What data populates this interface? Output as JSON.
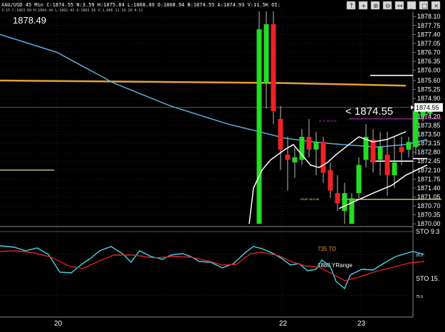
{
  "header": {
    "line1": "XAU/USD 45 Min  C:1874.55  N:3.59  H:1875.84  L:1868.49  O:1868.94  B:1874.55  A:1874.93  V:11.5K  OI:",
    "line2": "3:15  C:1863.69  H:1864.44  L:1862.43  O:1863.56  V:1,686  11-19-20  4:11"
  },
  "toolbar_icons": [
    "price-line-icon",
    "crosshair-icon",
    "zoom-in-icon",
    "zoom-out-icon",
    "pan-icon",
    "minimize-icon",
    "restore-icon",
    "close-icon"
  ],
  "top_price": "1878.49",
  "current_price_callout": "< 1874.55",
  "current_price_label": "1874.55",
  "annotations": {
    "magenta": "► W 1874.18",
    "yellow": "RSVP 1870.96",
    "td": "735 TD",
    "yrange": "1888 YRange"
  },
  "colors": {
    "up": "#22dd22",
    "down": "#ee2222",
    "ma_blue": "#5aaee0",
    "orange": "#e8a033",
    "white": "#ffffff",
    "yellow": "#e8e08a",
    "magenta": "#cc33cc",
    "sto_cyan": "#44d8ee",
    "sto_red": "#dd2222",
    "td_orange": "#f08a30",
    "grid": "#a0a0a0"
  },
  "chart_data": [
    {
      "type": "candlestick",
      "symbol": "XAU/USD",
      "timeframe": "45 Min",
      "y_axis": {
        "ticks": [
          "1870.00",
          "1870.35",
          "1870.70",
          "1871.05",
          "1871.40",
          "1871.75",
          "1872.10",
          "1872.45",
          "1872.80",
          "1873.15",
          "1873.50",
          "1873.85",
          "1874.20",
          "1874.55",
          "1874.90",
          "1875.25",
          "1875.60",
          "1876.00",
          "1876.35",
          "1876.70",
          "1877.05",
          "1877.40",
          "1877.75",
          "1878.10"
        ],
        "ylim": [
          1869.95,
          1878.3
        ]
      },
      "x_axis": {
        "ticks": [
          {
            "label": "20",
            "x": 40
          },
          {
            "label": "22",
            "x": 198
          },
          {
            "label": "23",
            "x": 253
          }
        ]
      },
      "grid": true,
      "candles": [
        {
          "x": 182,
          "o": 1870.0,
          "h": 1878.3,
          "l": 1870.0,
          "c": 1877.6
        },
        {
          "x": 187,
          "o": 1875.5,
          "h": 1878.3,
          "l": 1874.5,
          "c": 1877.8
        },
        {
          "x": 192,
          "o": 1877.8,
          "h": 1878.3,
          "l": 1873.9,
          "c": 1874.4
        },
        {
          "x": 197,
          "o": 1874.1,
          "h": 1874.6,
          "l": 1872.1,
          "c": 1872.9
        },
        {
          "x": 202,
          "o": 1872.7,
          "h": 1873.4,
          "l": 1871.3,
          "c": 1872.5
        },
        {
          "x": 207,
          "o": 1872.4,
          "h": 1873.0,
          "l": 1871.8,
          "c": 1872.6
        },
        {
          "x": 212,
          "o": 1872.5,
          "h": 1873.7,
          "l": 1872.3,
          "c": 1873.4
        },
        {
          "x": 217,
          "o": 1873.4,
          "h": 1874.1,
          "l": 1872.6,
          "c": 1872.9
        },
        {
          "x": 222,
          "o": 1872.9,
          "h": 1873.6,
          "l": 1871.9,
          "c": 1873.2
        },
        {
          "x": 227,
          "o": 1873.2,
          "h": 1873.4,
          "l": 1871.6,
          "c": 1872.0
        },
        {
          "x": 232,
          "o": 1872.1,
          "h": 1872.4,
          "l": 1871.0,
          "c": 1871.3
        },
        {
          "x": 237,
          "o": 1871.2,
          "h": 1871.9,
          "l": 1870.5,
          "c": 1870.8
        },
        {
          "x": 242,
          "o": 1870.5,
          "h": 1871.6,
          "l": 1870.0,
          "c": 1871.2
        },
        {
          "x": 247,
          "o": 1870.0,
          "h": 1871.2,
          "l": 1870.0,
          "c": 1871.0
        },
        {
          "x": 252,
          "o": 1871.2,
          "h": 1872.6,
          "l": 1871.0,
          "c": 1872.3
        },
        {
          "x": 257,
          "o": 1872.5,
          "h": 1873.9,
          "l": 1872.2,
          "c": 1873.4
        },
        {
          "x": 262,
          "o": 1873.3,
          "h": 1873.7,
          "l": 1872.0,
          "c": 1872.4
        },
        {
          "x": 267,
          "o": 1872.5,
          "h": 1873.6,
          "l": 1871.9,
          "c": 1873.0
        },
        {
          "x": 272,
          "o": 1872.7,
          "h": 1873.6,
          "l": 1871.1,
          "c": 1871.9
        },
        {
          "x": 277,
          "o": 1871.9,
          "h": 1873.4,
          "l": 1871.4,
          "c": 1872.4
        },
        {
          "x": 282,
          "o": 1873.0,
          "h": 1873.4,
          "l": 1872.3,
          "c": 1872.8
        },
        {
          "x": 287,
          "o": 1872.9,
          "h": 1873.4,
          "l": 1872.6,
          "c": 1873.2
        },
        {
          "x": 292,
          "o": 1873.0,
          "h": 1874.6,
          "l": 1872.7,
          "c": 1874.4
        },
        {
          "x": 297,
          "o": 1874.2,
          "h": 1874.7,
          "l": 1874.0,
          "c": 1874.4
        },
        {
          "x": 302,
          "o": 1874.3,
          "h": 1874.6,
          "l": 1874.2,
          "c": 1874.5
        }
      ],
      "lines": {
        "blue_ma": [
          [
            0,
            1877.4
          ],
          [
            40,
            1876.7
          ],
          [
            80,
            1875.5
          ],
          [
            120,
            1874.6
          ],
          [
            160,
            1873.9
          ],
          [
            182,
            1873.6
          ],
          [
            200,
            1873.35
          ],
          [
            220,
            1873.2
          ],
          [
            240,
            1873.1
          ],
          [
            265,
            1873.0
          ],
          [
            285,
            1873.1
          ],
          [
            300,
            1873.3
          ]
        ],
        "orange_ma": [
          [
            0,
            1875.6
          ],
          [
            100,
            1875.55
          ],
          [
            200,
            1875.5
          ],
          [
            285,
            1875.4
          ]
        ],
        "white_trail": [
          [
            175,
            1870.0
          ],
          [
            178,
            1871.4
          ],
          [
            184,
            1872.1
          ],
          [
            190,
            1872.5
          ],
          [
            200,
            1872.9
          ],
          [
            206,
            1873.1
          ],
          [
            212,
            1872.7
          ],
          [
            218,
            1872.3
          ],
          [
            224,
            1872.2
          ],
          [
            230,
            1872.4
          ],
          [
            236,
            1872.7
          ],
          [
            245,
            1873.1
          ],
          [
            252,
            1873.4
          ],
          [
            262,
            1873.2
          ],
          [
            272,
            1873.3
          ],
          [
            285,
            1873.6
          ]
        ],
        "white_lower": [
          [
            238,
            1870.6
          ],
          [
            250,
            1870.9
          ],
          [
            262,
            1871.2
          ],
          [
            275,
            1871.5
          ],
          [
            285,
            1871.9
          ],
          [
            300,
            1872.3
          ]
        ],
        "white_levels": [
          {
            "from_x": 260,
            "to_x": 435,
            "y": 1875.8
          },
          {
            "from_x": 260,
            "to_x": 580,
            "y": 1872.45
          },
          {
            "from_x": 300,
            "to_x": 348,
            "y": 1872.55
          }
        ],
        "magenta_level": {
          "from_x": 245,
          "to_x": 310,
          "y": 1874.1
        },
        "yellow_levels": [
          {
            "from_x": 240,
            "to_x": 310,
            "y": 1870.96
          },
          {
            "from_x": 0,
            "to_x": 38,
            "y": 1872.1
          }
        ]
      }
    },
    {
      "type": "line",
      "name": "STO",
      "y_axis": {
        "ticks": [
          "9.3",
          "25.0",
          "15.",
          "75.0"
        ]
      },
      "series": [
        {
          "color": "sto_cyan",
          "values": [
            [
              0,
              345
            ],
            [
              10,
              347
            ],
            [
              18,
              352
            ],
            [
              26,
              348
            ],
            [
              34,
              357
            ],
            [
              42,
              382
            ],
            [
              50,
              383
            ],
            [
              58,
              370
            ],
            [
              64,
              362
            ],
            [
              70,
              352
            ],
            [
              78,
              346
            ],
            [
              86,
              356
            ],
            [
              92,
              368
            ],
            [
              98,
              352
            ],
            [
              106,
              360
            ],
            [
              114,
              364
            ],
            [
              120,
              358
            ],
            [
              128,
              356
            ],
            [
              134,
              360
            ],
            [
              140,
              367
            ],
            [
              148,
              368
            ],
            [
              156,
              376
            ],
            [
              164,
              370
            ],
            [
              172,
              355
            ],
            [
              178,
              346
            ],
            [
              184,
              349
            ],
            [
              192,
              356
            ],
            [
              198,
              363
            ],
            [
              204,
              372
            ],
            [
              210,
              370
            ],
            [
              216,
              380
            ],
            [
              222,
              378
            ],
            [
              226,
              365
            ],
            [
              232,
              374
            ],
            [
              236,
              395
            ],
            [
              242,
              405
            ],
            [
              246,
              386
            ],
            [
              254,
              378
            ],
            [
              262,
              379
            ],
            [
              270,
              369
            ],
            [
              278,
              360
            ],
            [
              290,
              353
            ],
            [
              298,
              357
            ]
          ]
        },
        {
          "color": "sto_red",
          "values": [
            [
              0,
              353
            ],
            [
              12,
              352
            ],
            [
              24,
              355
            ],
            [
              36,
              361
            ],
            [
              48,
              373
            ],
            [
              58,
              377
            ],
            [
              70,
              366
            ],
            [
              80,
              358
            ],
            [
              94,
              358
            ],
            [
              108,
              362
            ],
            [
              122,
              360
            ],
            [
              134,
              361
            ],
            [
              146,
              366
            ],
            [
              156,
              372
            ],
            [
              166,
              371
            ],
            [
              176,
              356
            ],
            [
              184,
              354
            ],
            [
              196,
              359
            ],
            [
              204,
              367
            ],
            [
              214,
              373
            ],
            [
              224,
              375
            ],
            [
              234,
              385
            ],
            [
              242,
              394
            ],
            [
              252,
              389
            ],
            [
              264,
              381
            ],
            [
              276,
              375
            ],
            [
              288,
              369
            ],
            [
              298,
              367
            ]
          ]
        }
      ]
    }
  ]
}
